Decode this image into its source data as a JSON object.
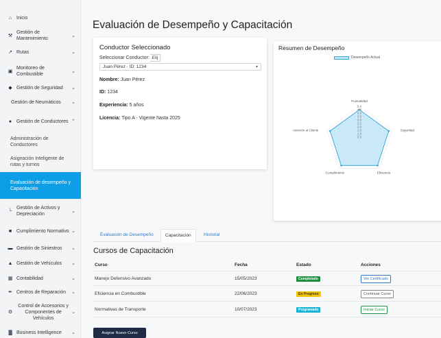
{
  "sidebar": {
    "items": [
      {
        "icon": "home-icon",
        "glyph": "⌂",
        "label": "Inicio"
      },
      {
        "icon": "wrench-icon",
        "glyph": "⚒",
        "label": "Gestión de Mantenimiento"
      },
      {
        "icon": "route-icon",
        "glyph": "↗",
        "label": "Rutas"
      },
      {
        "icon": "monitor-icon",
        "glyph": "▣",
        "label": "Monitoreo de Combustible"
      },
      {
        "icon": "shield-icon",
        "glyph": "◆",
        "label": "Gestión de Seguridad"
      },
      {
        "icon": "",
        "glyph": "",
        "label": "Gestión de Neumáticos"
      },
      {
        "icon": "user-icon",
        "glyph": "●",
        "label": "Gestión de Conductores"
      },
      {
        "icon": "",
        "glyph": "",
        "label": "Administración de Conductores"
      },
      {
        "icon": "",
        "glyph": "",
        "label": "Asignación Inteligente de rutas y turnos"
      },
      {
        "icon": "",
        "glyph": "",
        "label": "Evaluación de desempeño y Capacitación"
      },
      {
        "icon": "chart-icon",
        "glyph": "└",
        "label": "Gestión de Activos y Depreciación"
      },
      {
        "icon": "document-icon",
        "glyph": "■",
        "label": "Cumplimiento Normativo"
      },
      {
        "icon": "truck-icon",
        "glyph": "▬",
        "label": "Gestión de Siniestros"
      },
      {
        "icon": "car-icon",
        "glyph": "▲",
        "label": "Gestión de Vehículos"
      },
      {
        "icon": "calculator-icon",
        "glyph": "▦",
        "label": "Contabilidad"
      },
      {
        "icon": "tools-icon",
        "glyph": "✒",
        "label": "Centros de Reparación"
      },
      {
        "icon": "cogs-icon",
        "glyph": "⚙",
        "label": "Control de Accesorios y Componentes de Vehículos"
      },
      {
        "icon": "bi-icon",
        "glyph": "▓",
        "label": "Business Intelligence"
      }
    ]
  },
  "page": {
    "title": "Evaluación de Desempeño y Capacitación"
  },
  "driver_card": {
    "heading": "Conductor Seleccionado",
    "select_label": "Seleccionar Conductor:",
    "select_tab": "Elij",
    "selected": "Juan Pérez - ID: 1234",
    "name_label": "Nombre:",
    "name_value": "Juan Pérez",
    "id_label": "ID:",
    "id_value": "1234",
    "exp_label": "Experiencia:",
    "exp_value": "5 años",
    "lic_label": "Licencia:",
    "lic_value": "Tipo A - Vigente hasta 2025"
  },
  "chart_data": {
    "type": "radar",
    "title": "Resumen de Desempeño",
    "axes": [
      "Puntualidad",
      "Seguridad",
      "Eficiencia",
      "Cumplimiento",
      "Atención al Cliente"
    ],
    "ticks": [
      "0.5",
      "1.0",
      "1.5",
      "2.0",
      "2.5",
      "3.0",
      "3.5",
      "4.0",
      "4.5",
      "5.0"
    ],
    "range": [
      0,
      5
    ],
    "series": [
      {
        "name": "Desempeño Actual",
        "values": [
          4.5,
          4.5,
          4.5,
          4.5,
          4.5
        ]
      }
    ],
    "fill": "#bfe5f7",
    "stroke": "#3aa8dc"
  },
  "tabs": [
    {
      "label": "Evaluación de Desempeño"
    },
    {
      "label": "Capacitación"
    },
    {
      "label": "Historial"
    }
  ],
  "courses": {
    "title": "Cursos de Capacitación",
    "headers": [
      "Curso",
      "Fecha",
      "Estado",
      "Acciones"
    ],
    "rows": [
      {
        "course": "Manejo Defensivo Avanzado",
        "date": "15/05/2023",
        "status": "Completado",
        "action": "Ver Certificado"
      },
      {
        "course": "Eficiencia en Combustible",
        "date": "22/06/2023",
        "status": "En Progreso",
        "action": "Continuar Curso"
      },
      {
        "course": "Normativas de Transporte",
        "date": "10/07/2023",
        "status": "Programado",
        "action": "Iniciar Curso"
      }
    ],
    "assign_button": "Asignar Nuevo Curso"
  },
  "colors": {
    "active": "#0d9ee8",
    "navy": "#1f2a44",
    "green": "#1e8e3e",
    "yellow": "#f5c400",
    "cyan": "#17b4d3"
  }
}
